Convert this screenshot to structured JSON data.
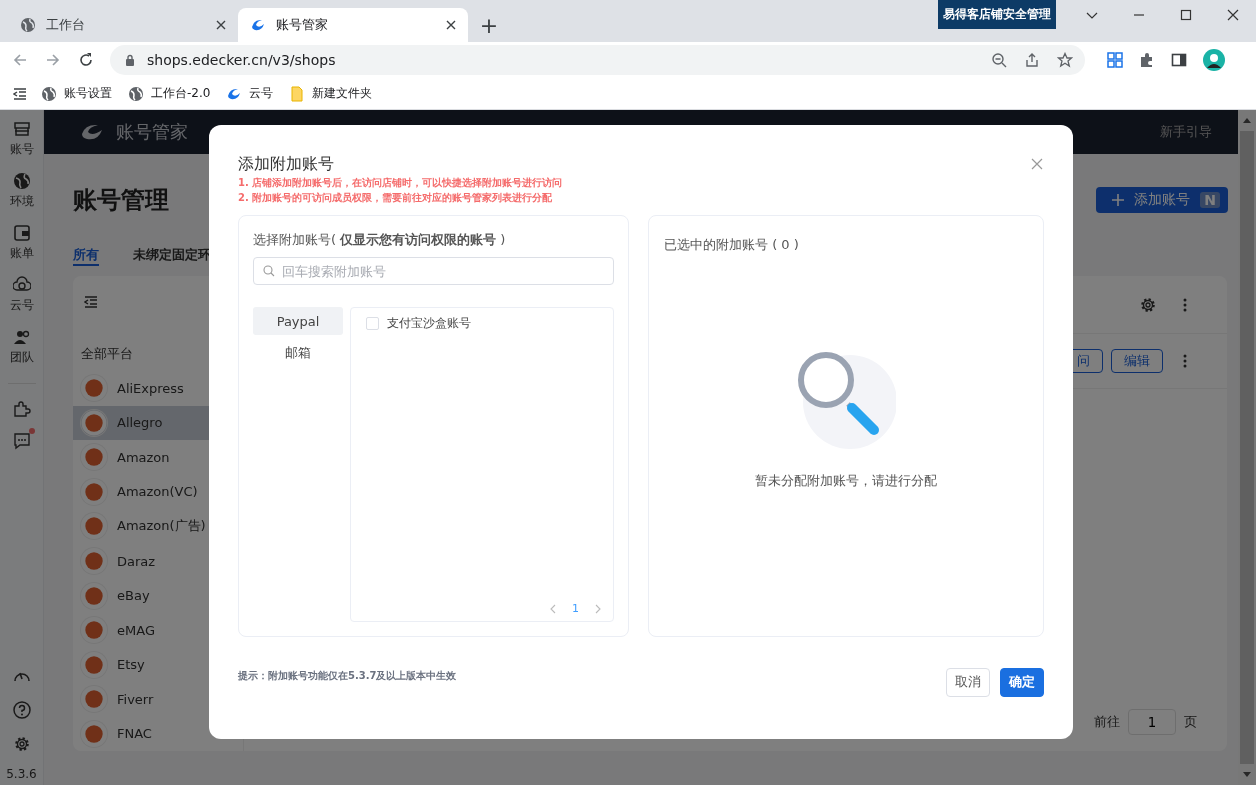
{
  "browser": {
    "tabs": [
      {
        "title": "工作台",
        "selected": false,
        "kind": "globe"
      },
      {
        "title": "账号管家",
        "selected": true,
        "kind": "logo"
      }
    ],
    "new_tab": "+",
    "extension_badge": "易得客店铺安全管理",
    "url": "shops.edecker.cn/v3/shops",
    "bookmarks": [
      {
        "label": "账号设置",
        "kind": "globe"
      },
      {
        "label": "工作台-2.0",
        "kind": "globe"
      },
      {
        "label": "云号",
        "kind": "logo"
      },
      {
        "label": "新建文件夹",
        "kind": "folder"
      }
    ]
  },
  "rail": {
    "items": [
      {
        "label": "账号",
        "kind": "shop"
      },
      {
        "label": "环境",
        "kind": "globe"
      },
      {
        "label": "账单",
        "kind": "wallet"
      },
      {
        "label": "云号",
        "kind": "cloud"
      },
      {
        "label": "团队",
        "kind": "team"
      }
    ],
    "extras": [
      {
        "kind": "puzzle",
        "badge": false
      },
      {
        "kind": "chat",
        "badge": true
      }
    ],
    "version": "5.3.6"
  },
  "app": {
    "brand": "账号管家",
    "guide": "新手引导",
    "title": "账号管理",
    "tabs": [
      {
        "label": "所有",
        "selected": true
      },
      {
        "label": "未绑定固定环",
        "selected": false
      }
    ],
    "add_button": "添加账号",
    "add_shortcut": "N",
    "platform_heading": "全部平台",
    "platforms": [
      {
        "name": "AliExpress",
        "selected": false
      },
      {
        "name": "Allegro",
        "selected": true
      },
      {
        "name": "Amazon",
        "selected": false
      },
      {
        "name": "Amazon(VC)",
        "selected": false
      },
      {
        "name": "Amazon(广告)",
        "selected": false
      },
      {
        "name": "Daraz",
        "selected": false
      },
      {
        "name": "eBay",
        "selected": false
      },
      {
        "name": "eMAG",
        "selected": false
      },
      {
        "name": "Etsy",
        "selected": false
      },
      {
        "name": "Fiverr",
        "selected": false
      },
      {
        "name": "FNAC",
        "selected": false
      }
    ],
    "row_buttons": [
      "问",
      "编辑"
    ],
    "goto_label": "前往",
    "goto_page": "1",
    "page_suffix": "页"
  },
  "dialog": {
    "title": "添加附加账号",
    "notes": [
      "1. 店铺添加附加账号后，在访问店铺时，可以快捷选择附加账号进行访问",
      "2. 附加账号的可访问成员权限，需要前往对应的账号管家列表进行分配"
    ],
    "source": {
      "heading": "选择附加账号( **仅显示您有访问权限的账号** )",
      "search_placeholder": "回车搜索附加账号",
      "categories": [
        {
          "label": "Paypal",
          "selected": true
        },
        {
          "label": "邮箱",
          "selected": false
        }
      ],
      "accounts": [
        {
          "name": "支付宝沙盒账号",
          "checked": false
        }
      ],
      "page": "1"
    },
    "chosen": {
      "heading": "已选中的附加账号 ( 0 )",
      "empty_text": "暂未分配附加账号，请进行分配"
    },
    "hint": "提示：附加账号功能仅在5.3.7及以上版本中生效",
    "buttons": [
      {
        "label": "取消",
        "kind": "default"
      },
      {
        "label": "确定",
        "kind": "primary"
      }
    ]
  }
}
